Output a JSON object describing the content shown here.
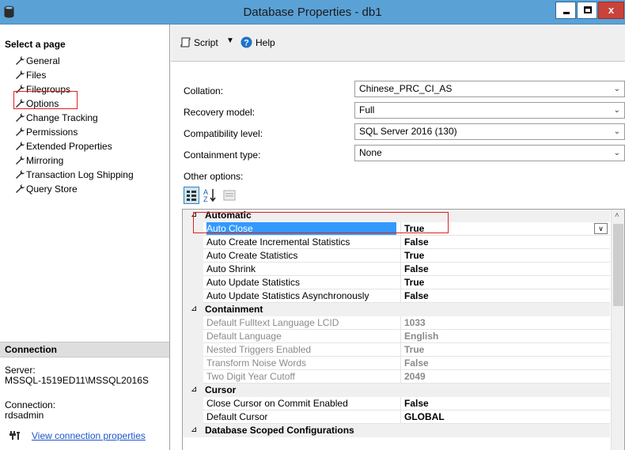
{
  "window": {
    "title": "Database Properties - db1",
    "close_label": "x"
  },
  "sidebar": {
    "heading": "Select a page",
    "items": [
      {
        "label": "General"
      },
      {
        "label": "Files"
      },
      {
        "label": "Filegroups"
      },
      {
        "label": "Options"
      },
      {
        "label": "Change Tracking"
      },
      {
        "label": "Permissions"
      },
      {
        "label": "Extended Properties"
      },
      {
        "label": "Mirroring"
      },
      {
        "label": "Transaction Log Shipping"
      },
      {
        "label": "Query Store"
      }
    ],
    "selected_item": "Options"
  },
  "connection": {
    "heading": "Connection",
    "server_label": "Server:",
    "server_value": "MSSQL-1519ED11\\MSSQL2016S",
    "connection_label": "Connection:",
    "connection_value": "rdsadmin",
    "link_text": "View connection properties"
  },
  "toolbar": {
    "script_label": "Script",
    "help_label": "Help"
  },
  "fields": {
    "collation": {
      "label": "Collation:",
      "value": "Chinese_PRC_CI_AS"
    },
    "recovery": {
      "label": "Recovery model:",
      "value": "Full"
    },
    "compat": {
      "label": "Compatibility level:",
      "value": "SQL Server 2016 (130)"
    },
    "containment": {
      "label": "Containment type:",
      "value": "None"
    },
    "other_options_label": "Other options:"
  },
  "grid": {
    "rows": [
      {
        "type": "category",
        "name": "Automatic"
      },
      {
        "type": "prop",
        "name": "Auto Close",
        "value": "True",
        "selected": true
      },
      {
        "type": "prop",
        "name": "Auto Create Incremental Statistics",
        "value": "False"
      },
      {
        "type": "prop",
        "name": "Auto Create Statistics",
        "value": "True"
      },
      {
        "type": "prop",
        "name": "Auto Shrink",
        "value": "False"
      },
      {
        "type": "prop",
        "name": "Auto Update Statistics",
        "value": "True"
      },
      {
        "type": "prop",
        "name": "Auto Update Statistics Asynchronously",
        "value": "False"
      },
      {
        "type": "category",
        "name": "Containment"
      },
      {
        "type": "prop",
        "name": "Default Fulltext Language LCID",
        "value": "1033",
        "disabled": true
      },
      {
        "type": "prop",
        "name": "Default Language",
        "value": "English",
        "disabled": true
      },
      {
        "type": "prop",
        "name": "Nested Triggers Enabled",
        "value": "True",
        "disabled": true
      },
      {
        "type": "prop",
        "name": "Transform Noise Words",
        "value": "False",
        "disabled": true
      },
      {
        "type": "prop",
        "name": "Two Digit Year Cutoff",
        "value": "2049",
        "disabled": true
      },
      {
        "type": "category",
        "name": "Cursor"
      },
      {
        "type": "prop",
        "name": "Close Cursor on Commit Enabled",
        "value": "False"
      },
      {
        "type": "prop",
        "name": "Default Cursor",
        "value": "GLOBAL"
      },
      {
        "type": "category",
        "name": "Database Scoped Configurations"
      }
    ]
  }
}
